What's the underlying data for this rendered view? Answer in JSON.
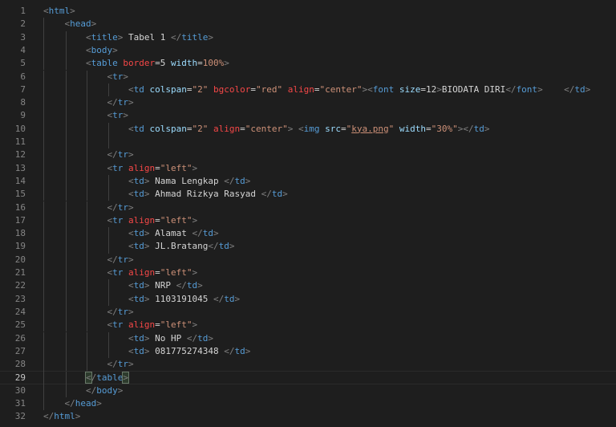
{
  "editor": {
    "current_line": 29,
    "lines": [
      {
        "n": "1",
        "i": 0,
        "tk": [
          [
            "p",
            "<"
          ],
          [
            "t",
            "html"
          ],
          [
            "p",
            ">"
          ]
        ]
      },
      {
        "n": "2",
        "i": 1,
        "tk": [
          [
            "p",
            "<"
          ],
          [
            "t",
            "head"
          ],
          [
            "p",
            ">"
          ]
        ]
      },
      {
        "n": "3",
        "i": 2,
        "tk": [
          [
            "p",
            "<"
          ],
          [
            "t",
            "title"
          ],
          [
            "p",
            "> "
          ],
          [
            "x",
            "Tabel 1 "
          ],
          [
            "p",
            "</"
          ],
          [
            "t",
            "title"
          ],
          [
            "p",
            ">"
          ]
        ]
      },
      {
        "n": "4",
        "i": 2,
        "tk": [
          [
            "p",
            "<"
          ],
          [
            "t",
            "body"
          ],
          [
            "p",
            ">"
          ]
        ]
      },
      {
        "n": "5",
        "i": 2,
        "tk": [
          [
            "p",
            "<"
          ],
          [
            "t",
            "table "
          ],
          [
            "d",
            "border"
          ],
          [
            "x",
            "=5 "
          ],
          [
            "a",
            "width"
          ],
          [
            "x",
            "="
          ],
          [
            "o",
            "100%"
          ],
          [
            "p",
            ">"
          ]
        ]
      },
      {
        "n": "6",
        "i": 3,
        "tk": [
          [
            "p",
            "<"
          ],
          [
            "t",
            "tr"
          ],
          [
            "p",
            ">"
          ]
        ]
      },
      {
        "n": "7",
        "i": 4,
        "tk": [
          [
            "p",
            "<"
          ],
          [
            "t",
            "td "
          ],
          [
            "a",
            "colspan"
          ],
          [
            "x",
            "="
          ],
          [
            "s",
            "\"2\" "
          ],
          [
            "d",
            "bgcolor"
          ],
          [
            "x",
            "="
          ],
          [
            "s",
            "\"red\" "
          ],
          [
            "d",
            "align"
          ],
          [
            "x",
            "="
          ],
          [
            "s",
            "\"center\""
          ],
          [
            "p",
            "><"
          ],
          [
            "t",
            "font "
          ],
          [
            "a",
            "size"
          ],
          [
            "x",
            "=12"
          ],
          [
            "p",
            ">"
          ],
          [
            "x",
            "BIODATA DIRI"
          ],
          [
            "p",
            "</"
          ],
          [
            "t",
            "font"
          ],
          [
            "p",
            ">    </"
          ],
          [
            "t",
            "td"
          ],
          [
            "p",
            ">"
          ]
        ]
      },
      {
        "n": "8",
        "i": 3,
        "tk": [
          [
            "p",
            "</"
          ],
          [
            "t",
            "tr"
          ],
          [
            "p",
            ">"
          ]
        ]
      },
      {
        "n": "9",
        "i": 3,
        "tk": [
          [
            "p",
            "<"
          ],
          [
            "t",
            "tr"
          ],
          [
            "p",
            ">"
          ]
        ]
      },
      {
        "n": "10",
        "i": 4,
        "tk": [
          [
            "p",
            "<"
          ],
          [
            "t",
            "td "
          ],
          [
            "a",
            "colspan"
          ],
          [
            "x",
            "="
          ],
          [
            "s",
            "\"2\" "
          ],
          [
            "d",
            "align"
          ],
          [
            "x",
            "="
          ],
          [
            "s",
            "\"center\""
          ],
          [
            "p",
            "> <"
          ],
          [
            "t",
            "img "
          ],
          [
            "a",
            "src"
          ],
          [
            "x",
            "="
          ],
          [
            "s",
            "\""
          ],
          [
            "su",
            "kya.png"
          ],
          [
            "s",
            "\" "
          ],
          [
            "a",
            "width"
          ],
          [
            "x",
            "="
          ],
          [
            "s",
            "\"30%\""
          ],
          [
            "p",
            "></"
          ],
          [
            "t",
            "td"
          ],
          [
            "p",
            ">"
          ]
        ]
      },
      {
        "n": "11",
        "i": 4,
        "tk": []
      },
      {
        "n": "12",
        "i": 3,
        "tk": [
          [
            "p",
            "</"
          ],
          [
            "t",
            "tr"
          ],
          [
            "p",
            ">"
          ]
        ]
      },
      {
        "n": "13",
        "i": 3,
        "tk": [
          [
            "p",
            "<"
          ],
          [
            "t",
            "tr "
          ],
          [
            "d",
            "align"
          ],
          [
            "x",
            "="
          ],
          [
            "s",
            "\"left\""
          ],
          [
            "p",
            ">"
          ]
        ]
      },
      {
        "n": "14",
        "i": 4,
        "tk": [
          [
            "p",
            "<"
          ],
          [
            "t",
            "td"
          ],
          [
            "p",
            "> "
          ],
          [
            "x",
            "Nama Lengkap "
          ],
          [
            "p",
            "</"
          ],
          [
            "t",
            "td"
          ],
          [
            "p",
            ">"
          ]
        ]
      },
      {
        "n": "15",
        "i": 4,
        "tk": [
          [
            "p",
            "<"
          ],
          [
            "t",
            "td"
          ],
          [
            "p",
            "> "
          ],
          [
            "x",
            "Ahmad Rizkya Rasyad "
          ],
          [
            "p",
            "</"
          ],
          [
            "t",
            "td"
          ],
          [
            "p",
            ">"
          ]
        ]
      },
      {
        "n": "16",
        "i": 3,
        "tk": [
          [
            "p",
            "</"
          ],
          [
            "t",
            "tr"
          ],
          [
            "p",
            ">"
          ]
        ]
      },
      {
        "n": "17",
        "i": 3,
        "tk": [
          [
            "p",
            "<"
          ],
          [
            "t",
            "tr "
          ],
          [
            "d",
            "align"
          ],
          [
            "x",
            "="
          ],
          [
            "s",
            "\"left\""
          ],
          [
            "p",
            ">"
          ]
        ]
      },
      {
        "n": "18",
        "i": 4,
        "tk": [
          [
            "p",
            "<"
          ],
          [
            "t",
            "td"
          ],
          [
            "p",
            "> "
          ],
          [
            "x",
            "Alamat "
          ],
          [
            "p",
            "</"
          ],
          [
            "t",
            "td"
          ],
          [
            "p",
            ">"
          ]
        ]
      },
      {
        "n": "19",
        "i": 4,
        "tk": [
          [
            "p",
            "<"
          ],
          [
            "t",
            "td"
          ],
          [
            "p",
            "> "
          ],
          [
            "x",
            "JL.Bratang"
          ],
          [
            "p",
            "</"
          ],
          [
            "t",
            "td"
          ],
          [
            "p",
            ">"
          ]
        ]
      },
      {
        "n": "20",
        "i": 3,
        "tk": [
          [
            "p",
            "</"
          ],
          [
            "t",
            "tr"
          ],
          [
            "p",
            ">"
          ]
        ]
      },
      {
        "n": "21",
        "i": 3,
        "tk": [
          [
            "p",
            "<"
          ],
          [
            "t",
            "tr "
          ],
          [
            "d",
            "align"
          ],
          [
            "x",
            "="
          ],
          [
            "s",
            "\"left\""
          ],
          [
            "p",
            ">"
          ]
        ]
      },
      {
        "n": "22",
        "i": 4,
        "tk": [
          [
            "p",
            "<"
          ],
          [
            "t",
            "td"
          ],
          [
            "p",
            "> "
          ],
          [
            "x",
            "NRP "
          ],
          [
            "p",
            "</"
          ],
          [
            "t",
            "td"
          ],
          [
            "p",
            ">"
          ]
        ]
      },
      {
        "n": "23",
        "i": 4,
        "tk": [
          [
            "p",
            "<"
          ],
          [
            "t",
            "td"
          ],
          [
            "p",
            "> "
          ],
          [
            "x",
            "1103191045 "
          ],
          [
            "p",
            "</"
          ],
          [
            "t",
            "td"
          ],
          [
            "p",
            ">"
          ]
        ]
      },
      {
        "n": "24",
        "i": 3,
        "tk": [
          [
            "p",
            "</"
          ],
          [
            "t",
            "tr"
          ],
          [
            "p",
            ">"
          ]
        ]
      },
      {
        "n": "25",
        "i": 3,
        "tk": [
          [
            "p",
            "<"
          ],
          [
            "t",
            "tr "
          ],
          [
            "d",
            "align"
          ],
          [
            "x",
            "="
          ],
          [
            "s",
            "\"left\""
          ],
          [
            "p",
            ">"
          ]
        ]
      },
      {
        "n": "26",
        "i": 4,
        "tk": [
          [
            "p",
            "<"
          ],
          [
            "t",
            "td"
          ],
          [
            "p",
            "> "
          ],
          [
            "x",
            "No HP "
          ],
          [
            "p",
            "</"
          ],
          [
            "t",
            "td"
          ],
          [
            "p",
            ">"
          ]
        ]
      },
      {
        "n": "27",
        "i": 4,
        "tk": [
          [
            "p",
            "<"
          ],
          [
            "t",
            "td"
          ],
          [
            "p",
            "> "
          ],
          [
            "x",
            "081775274348 "
          ],
          [
            "p",
            "</"
          ],
          [
            "t",
            "td"
          ],
          [
            "p",
            ">"
          ]
        ]
      },
      {
        "n": "28",
        "i": 3,
        "tk": [
          [
            "p",
            "</"
          ],
          [
            "t",
            "tr"
          ],
          [
            "p",
            ">"
          ]
        ]
      },
      {
        "n": "29",
        "i": 2,
        "tk": [
          [
            "pb",
            "<"
          ],
          [
            "p",
            "/"
          ],
          [
            "t",
            "table"
          ],
          [
            "pb",
            ">"
          ]
        ]
      },
      {
        "n": "30",
        "i": 2,
        "tk": [
          [
            "p",
            "</"
          ],
          [
            "t",
            "body"
          ],
          [
            "p",
            ">"
          ]
        ]
      },
      {
        "n": "31",
        "i": 1,
        "tk": [
          [
            "p",
            "</"
          ],
          [
            "t",
            "head"
          ],
          [
            "p",
            ">"
          ]
        ]
      },
      {
        "n": "32",
        "i": 0,
        "tk": [
          [
            "p",
            "</"
          ],
          [
            "t",
            "html"
          ],
          [
            "p",
            ">"
          ]
        ]
      }
    ]
  }
}
